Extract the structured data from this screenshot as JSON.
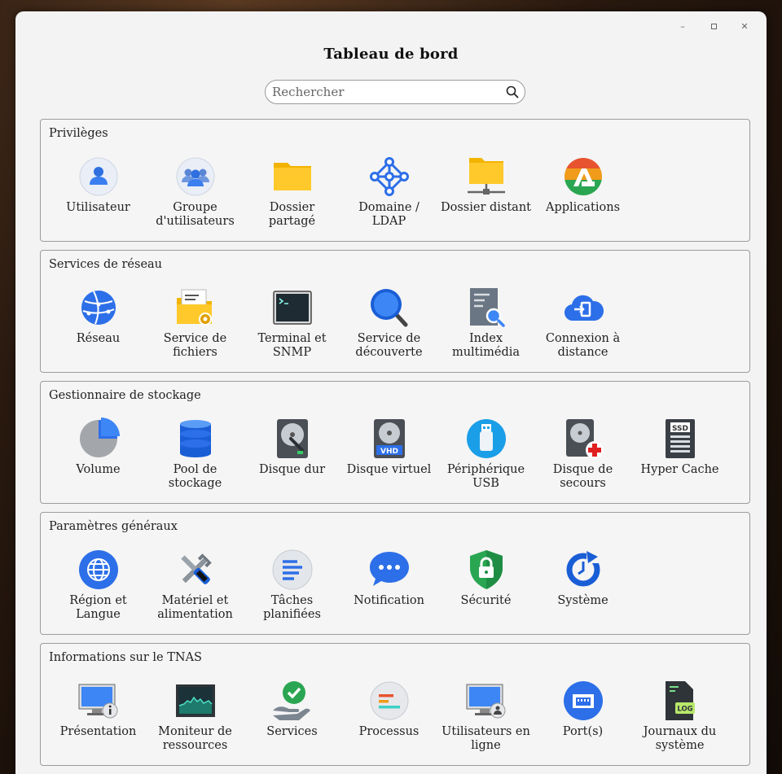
{
  "window": {
    "title": "Tableau de bord",
    "controls": [
      "–",
      "",
      "✕"
    ]
  },
  "search": {
    "placeholder": "Rechercher",
    "icon": "search-icon"
  },
  "sections": [
    {
      "title": "Privilèges",
      "items": [
        {
          "label": "Utilisateur",
          "icon": "user-icon"
        },
        {
          "label": "Groupe\nd'utilisateurs",
          "icon": "user-group-icon"
        },
        {
          "label": "Dossier\npartagé",
          "icon": "shared-folder-icon"
        },
        {
          "label": "Domaine /\nLDAP",
          "icon": "domain-ldap-icon"
        },
        {
          "label": "Dossier distant",
          "icon": "remote-folder-icon"
        },
        {
          "label": "Applications",
          "icon": "applications-icon"
        }
      ]
    },
    {
      "title": "Services de réseau",
      "items": [
        {
          "label": "Réseau",
          "icon": "network-icon"
        },
        {
          "label": "Service de\nfichiers",
          "icon": "file-service-icon"
        },
        {
          "label": "Terminal et\nSNMP",
          "icon": "terminal-icon"
        },
        {
          "label": "Service de\ndécouverte",
          "icon": "discovery-icon"
        },
        {
          "label": "Index\nmultimédia",
          "icon": "media-index-icon"
        },
        {
          "label": "Connexion à\ndistance",
          "icon": "remote-connection-icon"
        }
      ]
    },
    {
      "title": "Gestionnaire de stockage",
      "items": [
        {
          "label": "Volume",
          "icon": "volume-icon"
        },
        {
          "label": "Pool de\nstockage",
          "icon": "storage-pool-icon"
        },
        {
          "label": "Disque dur",
          "icon": "hard-disk-icon"
        },
        {
          "label": "Disque virtuel",
          "icon": "virtual-disk-icon"
        },
        {
          "label": "Périphérique\nUSB",
          "icon": "usb-icon"
        },
        {
          "label": "Disque de\nsecours",
          "icon": "spare-disk-icon"
        },
        {
          "label": "Hyper Cache",
          "icon": "ssd-cache-icon"
        }
      ]
    },
    {
      "title": "Paramètres généraux",
      "items": [
        {
          "label": "Région et\nLangue",
          "icon": "globe-icon"
        },
        {
          "label": "Matériel et\nalimentation",
          "icon": "tools-icon"
        },
        {
          "label": "Tâches\nplanifiées",
          "icon": "scheduled-tasks-icon"
        },
        {
          "label": "Notification",
          "icon": "chat-bubble-icon"
        },
        {
          "label": "Sécurité",
          "icon": "shield-lock-icon"
        },
        {
          "label": "Système",
          "icon": "system-refresh-icon"
        }
      ]
    },
    {
      "title": "Informations sur le TNAS",
      "items": [
        {
          "label": "Présentation",
          "icon": "monitor-info-icon"
        },
        {
          "label": "Moniteur de\nressources",
          "icon": "resource-monitor-icon"
        },
        {
          "label": "Services",
          "icon": "services-check-icon"
        },
        {
          "label": "Processus",
          "icon": "process-icon"
        },
        {
          "label": "Utilisateurs en\nligne",
          "icon": "online-users-icon"
        },
        {
          "label": "Port(s)",
          "icon": "port-icon"
        },
        {
          "label": "Journaux du\nsystème",
          "icon": "log-file-icon"
        }
      ]
    }
  ]
}
